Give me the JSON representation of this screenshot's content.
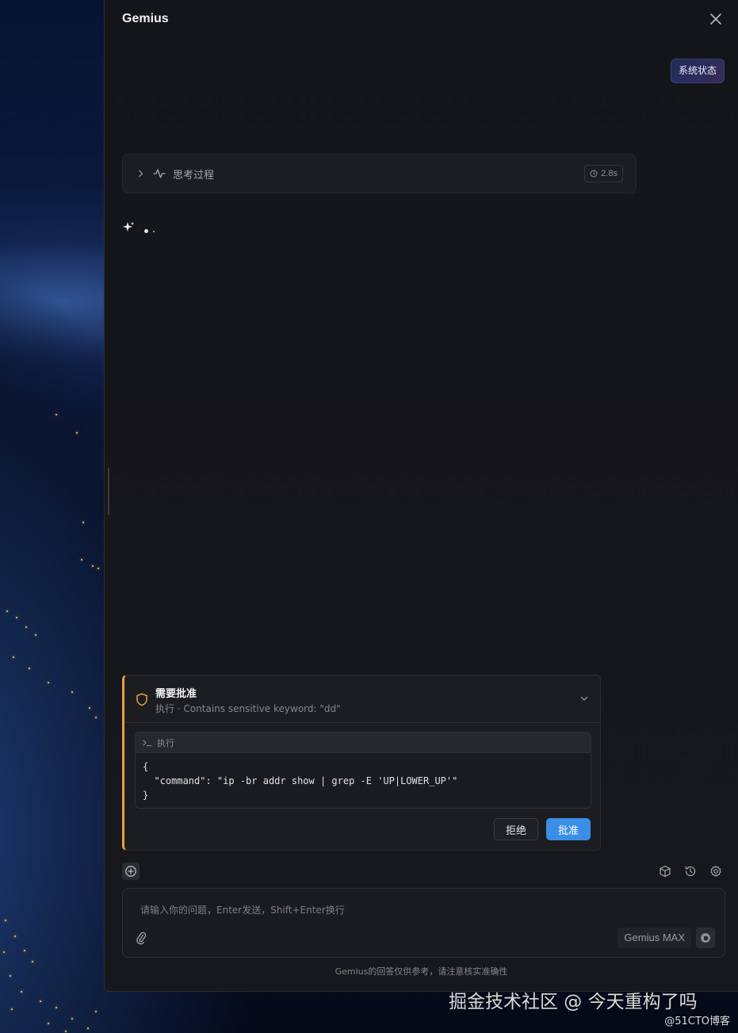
{
  "app": {
    "title": "Gemius"
  },
  "header": {
    "system_status_label": "系统状态"
  },
  "thinking": {
    "label": "思考过程",
    "duration": "2.8s"
  },
  "approval": {
    "title": "需要批准",
    "subtitle": "执行 · Contains sensitive keyword: \"dd\"",
    "code_header": "执行",
    "code": "{\n  \"command\": \"ip -br addr show | grep -E 'UP|LOWER_UP'\"\n}",
    "reject_label": "拒绝",
    "approve_label": "批准",
    "accent_color": "#e8a33a"
  },
  "input": {
    "placeholder": "请输入你的问题，Enter发送，Shift+Enter换行",
    "value": "",
    "model_label": "Gemius MAX"
  },
  "toolbar": {
    "icons": [
      "new-chat-icon",
      "cube-icon",
      "history-icon",
      "settings-icon"
    ]
  },
  "footer": {
    "disclaimer": "Gemius的回答仅供参考，请注意核实准确性"
  },
  "watermark": {
    "main": "掘金技术社区 @ 今天重构了吗",
    "sub": "@51CTO博客"
  },
  "colors": {
    "primary": "#3b8ee6",
    "warning": "#e8a33a",
    "panel_bg": "#16171b"
  }
}
